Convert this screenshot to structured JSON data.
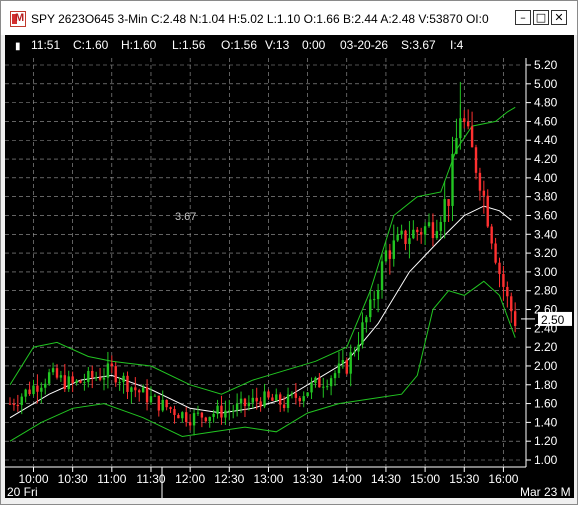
{
  "window": {
    "title": "SPY 2623O645 3-Min C:2.48 N:1.04 H:5.02 L:1.10 O:1.66 B:2.44 A:2.48 V:53870 OI:0",
    "buttons": {
      "minimize": "–",
      "maximize": "□",
      "close": "✕"
    }
  },
  "infobar": {
    "marker": "▮",
    "time": "11:51",
    "close": "C:1.60",
    "high": "H:1.60",
    "low": "L:1.56",
    "open": "O:1.56",
    "volume": "V:13",
    "elapsed": "0:00",
    "date": "03-20-26",
    "s": "S:3.67",
    "i": "I:4"
  },
  "annotation": "3.67",
  "colors": {
    "up": "#22c522",
    "down": "#ff3030",
    "band": "#22c522",
    "mid": "#ffffff",
    "grid": "#a0a0a0",
    "axis": "#ffffff"
  },
  "chart_data": {
    "type": "candlestick",
    "title": "SPY 2623O645 3-Min",
    "y_ticks": [
      "5.20",
      "5.00",
      "4.80",
      "4.60",
      "4.40",
      "4.20",
      "4.00",
      "3.80",
      "3.60",
      "3.40",
      "3.20",
      "3.00",
      "2.80",
      "2.60",
      "2.40",
      "2.20",
      "2.00",
      "1.80",
      "1.60",
      "1.40",
      "1.20",
      "1.00"
    ],
    "ylim": [
      1.0,
      5.2
    ],
    "x_ticks": [
      "10:00",
      "10:30",
      "11:00",
      "11:30",
      "12:00",
      "12:30",
      "13:00",
      "13:30",
      "14:00",
      "14:30",
      "15:00",
      "15:30",
      "16:00"
    ],
    "date_labels": {
      "left": "20 Fri",
      "right": "Mar 23 M"
    },
    "last_price": "2.50",
    "grid": true,
    "series": [
      {
        "name": "price",
        "points": [
          [
            9.7,
            1.6
          ],
          [
            10.2,
            1.9
          ],
          [
            10.5,
            1.8
          ],
          [
            11.0,
            1.95
          ],
          [
            11.3,
            1.75
          ],
          [
            11.6,
            1.6
          ],
          [
            12.0,
            1.45
          ],
          [
            12.3,
            1.5
          ],
          [
            12.6,
            1.55
          ],
          [
            12.9,
            1.65
          ],
          [
            13.2,
            1.6
          ],
          [
            13.6,
            1.8
          ],
          [
            14.0,
            2.0
          ],
          [
            14.3,
            2.6
          ],
          [
            14.5,
            3.2
          ],
          [
            14.8,
            3.4
          ],
          [
            15.1,
            3.5
          ],
          [
            15.3,
            3.8
          ],
          [
            15.45,
            4.7
          ],
          [
            15.55,
            4.4
          ],
          [
            15.7,
            4.0
          ],
          [
            15.85,
            3.4
          ],
          [
            15.95,
            3.0
          ],
          [
            16.05,
            2.7
          ],
          [
            16.15,
            2.48
          ]
        ]
      },
      {
        "name": "upper band",
        "points": [
          [
            9.7,
            1.8
          ],
          [
            10.0,
            2.2
          ],
          [
            10.3,
            2.25
          ],
          [
            10.7,
            2.1
          ],
          [
            11.0,
            2.05
          ],
          [
            11.5,
            2.0
          ],
          [
            12.0,
            1.8
          ],
          [
            12.4,
            1.7
          ],
          [
            12.8,
            1.85
          ],
          [
            13.2,
            1.95
          ],
          [
            13.6,
            2.05
          ],
          [
            14.0,
            2.2
          ],
          [
            14.3,
            2.8
          ],
          [
            14.6,
            3.6
          ],
          [
            14.9,
            3.8
          ],
          [
            15.2,
            3.85
          ],
          [
            15.4,
            4.3
          ],
          [
            15.6,
            4.55
          ],
          [
            15.9,
            4.6
          ],
          [
            16.05,
            4.7
          ],
          [
            16.15,
            4.75
          ]
        ]
      },
      {
        "name": "middle band",
        "points": [
          [
            9.7,
            1.45
          ],
          [
            10.2,
            1.7
          ],
          [
            10.6,
            1.85
          ],
          [
            11.0,
            1.9
          ],
          [
            11.5,
            1.75
          ],
          [
            12.0,
            1.55
          ],
          [
            12.4,
            1.5
          ],
          [
            12.8,
            1.55
          ],
          [
            13.2,
            1.65
          ],
          [
            13.6,
            1.85
          ],
          [
            14.0,
            2.05
          ],
          [
            14.4,
            2.45
          ],
          [
            14.8,
            3.0
          ],
          [
            15.2,
            3.35
          ],
          [
            15.5,
            3.6
          ],
          [
            15.75,
            3.7
          ],
          [
            15.95,
            3.65
          ],
          [
            16.1,
            3.55
          ]
        ]
      },
      {
        "name": "lower band",
        "points": [
          [
            9.7,
            1.2
          ],
          [
            10.1,
            1.4
          ],
          [
            10.5,
            1.55
          ],
          [
            10.9,
            1.6
          ],
          [
            11.4,
            1.45
          ],
          [
            11.9,
            1.25
          ],
          [
            12.3,
            1.3
          ],
          [
            12.7,
            1.35
          ],
          [
            13.1,
            1.3
          ],
          [
            13.5,
            1.5
          ],
          [
            13.9,
            1.6
          ],
          [
            14.3,
            1.65
          ],
          [
            14.7,
            1.7
          ],
          [
            14.9,
            1.9
          ],
          [
            15.1,
            2.6
          ],
          [
            15.3,
            2.8
          ],
          [
            15.5,
            2.75
          ],
          [
            15.75,
            2.9
          ],
          [
            15.95,
            2.75
          ],
          [
            16.15,
            2.3
          ]
        ]
      }
    ]
  }
}
